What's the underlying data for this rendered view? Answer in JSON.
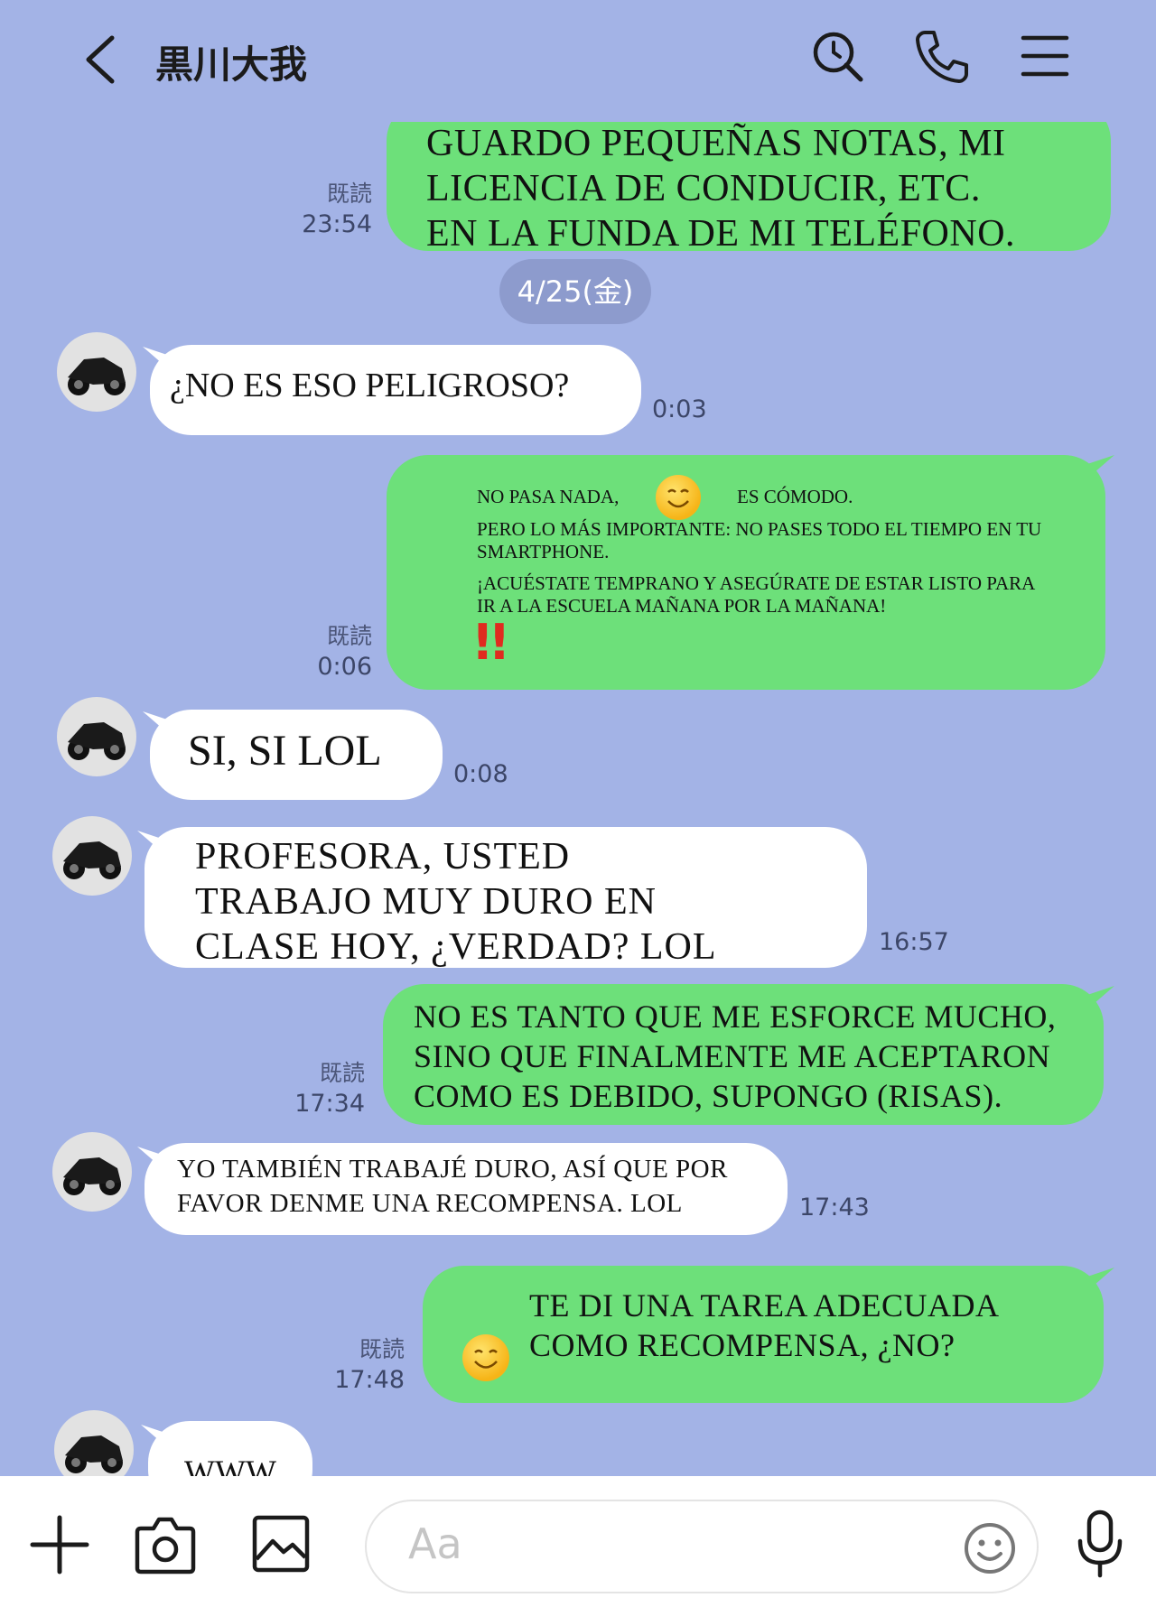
{
  "header": {
    "title": "黒川大我",
    "icons": [
      "chevron-left-icon",
      "search-icon",
      "phone-icon",
      "menu-icon"
    ]
  },
  "date_separator": "4/25(金)",
  "messages": [
    {
      "from": "me",
      "lines": [
        "GUARDO PEQUEÑAS NOTAS, MI",
        "LICENCIA DE CONDUCIR, ETC.",
        "EN LA FUNDA DE MI TELÉFONO."
      ],
      "read": "既読",
      "time": "23:54"
    },
    {
      "from": "contact",
      "lines": [
        "¿NO ES ESO PELIGROSO?"
      ],
      "time": "0:03"
    },
    {
      "from": "me",
      "line1_a": "NO PASA NADA,",
      "line1_b": "ES CÓMODO.",
      "lines": [
        "PERO LO MÁS IMPORTANTE: NO PASES TODO EL TIEMPO EN TU",
        "SMARTPHONE.",
        "¡ACUÉSTATE TEMPRANO Y ASEGÚRATE DE ESTAR LISTO PARA",
        "IR A LA ESCUELA MAÑANA POR LA MAÑANA!"
      ],
      "mark": "!!",
      "read": "既読",
      "time": "0:06"
    },
    {
      "from": "contact",
      "lines": [
        "SI, SI LOL"
      ],
      "time": "0:08"
    },
    {
      "from": "contact",
      "lines": [
        "PROFESORA, USTED",
        "TRABAJO MUY DURO EN",
        "CLASE HOY, ¿VERDAD? LOL"
      ],
      "time": "16:57"
    },
    {
      "from": "me",
      "lines": [
        "NO ES TANTO QUE ME ESFORCE MUCHO,",
        "SINO QUE FINALMENTE ME ACEPTARON",
        "COMO ES DEBIDO, SUPONGO (RISAS)."
      ],
      "read": "既読",
      "time": "17:34"
    },
    {
      "from": "contact",
      "lines": [
        "YO TAMBIÉN TRABAJÉ DURO, ASÍ QUE POR",
        "FAVOR DENME UNA RECOMPENSA. LOL"
      ],
      "time": "17:43"
    },
    {
      "from": "me",
      "lines": [
        "TE DI UNA TAREA ADECUADA",
        "COMO RECOMPENSA, ¿NO?"
      ],
      "read": "既読",
      "time": "17:48"
    },
    {
      "from": "contact",
      "lines": [
        "WWW"
      ]
    }
  ],
  "input": {
    "placeholder": "Aa",
    "icons": [
      "plus-icon",
      "camera-icon",
      "image-icon",
      "emoji-icon",
      "microphone-icon"
    ]
  },
  "colors": {
    "background": "#a3b3e6",
    "outgoing_bubble": "#6de07a",
    "incoming_bubble": "#ffffff",
    "date_pill": "#8d9bcd"
  }
}
